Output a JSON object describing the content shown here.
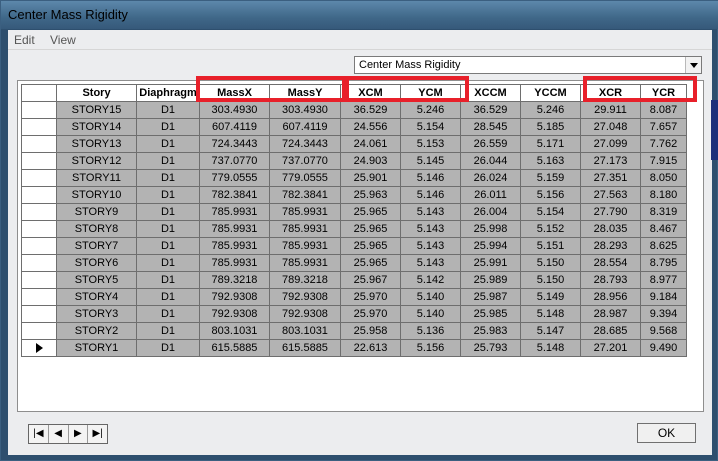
{
  "window": {
    "title": "Center Mass Rigidity"
  },
  "menu": {
    "edit": "Edit",
    "view": "View"
  },
  "combo": {
    "value": "Center Mass Rigidity"
  },
  "table": {
    "columns": [
      "Story",
      "Diaphragm",
      "MassX",
      "MassY",
      "XCM",
      "YCM",
      "XCCM",
      "YCCM",
      "XCR",
      "YCR"
    ],
    "rows": [
      [
        "STORY15",
        "D1",
        "303.4930",
        "303.4930",
        "36.529",
        "5.246",
        "36.529",
        "5.246",
        "29.911",
        "8.087"
      ],
      [
        "STORY14",
        "D1",
        "607.4119",
        "607.4119",
        "24.556",
        "5.154",
        "28.545",
        "5.185",
        "27.048",
        "7.657"
      ],
      [
        "STORY13",
        "D1",
        "724.3443",
        "724.3443",
        "24.061",
        "5.153",
        "26.559",
        "5.171",
        "27.099",
        "7.762"
      ],
      [
        "STORY12",
        "D1",
        "737.0770",
        "737.0770",
        "24.903",
        "5.145",
        "26.044",
        "5.163",
        "27.173",
        "7.915"
      ],
      [
        "STORY11",
        "D1",
        "779.0555",
        "779.0555",
        "25.901",
        "5.146",
        "26.024",
        "5.159",
        "27.351",
        "8.050"
      ],
      [
        "STORY10",
        "D1",
        "782.3841",
        "782.3841",
        "25.963",
        "5.146",
        "26.011",
        "5.156",
        "27.563",
        "8.180"
      ],
      [
        "STORY9",
        "D1",
        "785.9931",
        "785.9931",
        "25.965",
        "5.143",
        "26.004",
        "5.154",
        "27.790",
        "8.319"
      ],
      [
        "STORY8",
        "D1",
        "785.9931",
        "785.9931",
        "25.965",
        "5.143",
        "25.998",
        "5.152",
        "28.035",
        "8.467"
      ],
      [
        "STORY7",
        "D1",
        "785.9931",
        "785.9931",
        "25.965",
        "5.143",
        "25.994",
        "5.151",
        "28.293",
        "8.625"
      ],
      [
        "STORY6",
        "D1",
        "785.9931",
        "785.9931",
        "25.965",
        "5.143",
        "25.991",
        "5.150",
        "28.554",
        "8.795"
      ],
      [
        "STORY5",
        "D1",
        "789.3218",
        "789.3218",
        "25.967",
        "5.142",
        "25.989",
        "5.150",
        "28.793",
        "8.977"
      ],
      [
        "STORY4",
        "D1",
        "792.9308",
        "792.9308",
        "25.970",
        "5.140",
        "25.987",
        "5.149",
        "28.956",
        "9.184"
      ],
      [
        "STORY3",
        "D1",
        "792.9308",
        "792.9308",
        "25.970",
        "5.140",
        "25.985",
        "5.148",
        "28.987",
        "9.394"
      ],
      [
        "STORY2",
        "D1",
        "803.1031",
        "803.1031",
        "25.958",
        "5.136",
        "25.983",
        "5.147",
        "28.685",
        "9.568"
      ],
      [
        "STORY1",
        "D1",
        "615.5885",
        "615.5885",
        "22.613",
        "5.156",
        "25.793",
        "5.148",
        "27.201",
        "9.490"
      ]
    ],
    "current_row": "STORY1"
  },
  "buttons": {
    "ok": "OK"
  },
  "colors": {
    "highlight": "#e8202a",
    "cell_bg": "#b3b3b3"
  },
  "icons": [
    "first-record-icon",
    "prev-record-icon",
    "next-record-icon",
    "last-record-icon",
    "row-pointer-icon",
    "dropdown-arrow-icon"
  ]
}
